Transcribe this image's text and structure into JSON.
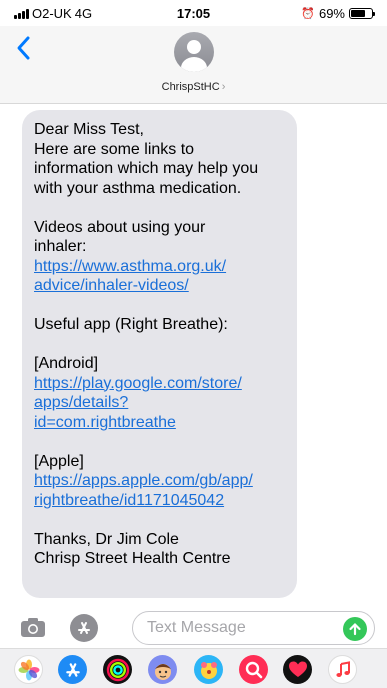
{
  "status_bar": {
    "carrier": "O2-UK",
    "network": "4G",
    "time": "17:05",
    "battery_percent": "69%",
    "battery_level": 0.69
  },
  "header": {
    "contact_name": "ChrispStHC",
    "chevron": "›"
  },
  "message": {
    "lines": [
      "Dear Miss Test,",
      "Here are some links to",
      "information which may help you",
      "with your asthma medication.",
      "Videos about using your",
      "inhaler:",
      "Useful app (Right Breathe):",
      "[Android]",
      "[Apple]",
      "Thanks, Dr Jim Cole",
      "Chrisp Street Health Centre"
    ],
    "links": [
      [
        "https://www.asthma.org.uk/",
        "advice/inhaler-videos/"
      ],
      [
        "https://play.google.com/store/",
        "apps/details?",
        "id=com.rightbreathe"
      ],
      [
        "https://apps.apple.com/gb/app/",
        "rightbreathe/id1171045042"
      ]
    ]
  },
  "input": {
    "placeholder": "Text Message",
    "value": ""
  },
  "colors": {
    "bubble": "#e5e5ea",
    "link": "#1a6fd8",
    "send": "#34c759",
    "ios_blue": "#007aff"
  },
  "icons": {
    "back": "chevron-left-icon",
    "camera": "camera-icon",
    "apps": "app-store-icon",
    "send": "arrow-up-icon",
    "drawer": [
      "photos-icon",
      "app-store-icon",
      "activity-icon",
      "memoji-icon",
      "stickers-icon",
      "search-images-icon",
      "digital-touch-icon",
      "music-icon"
    ]
  }
}
